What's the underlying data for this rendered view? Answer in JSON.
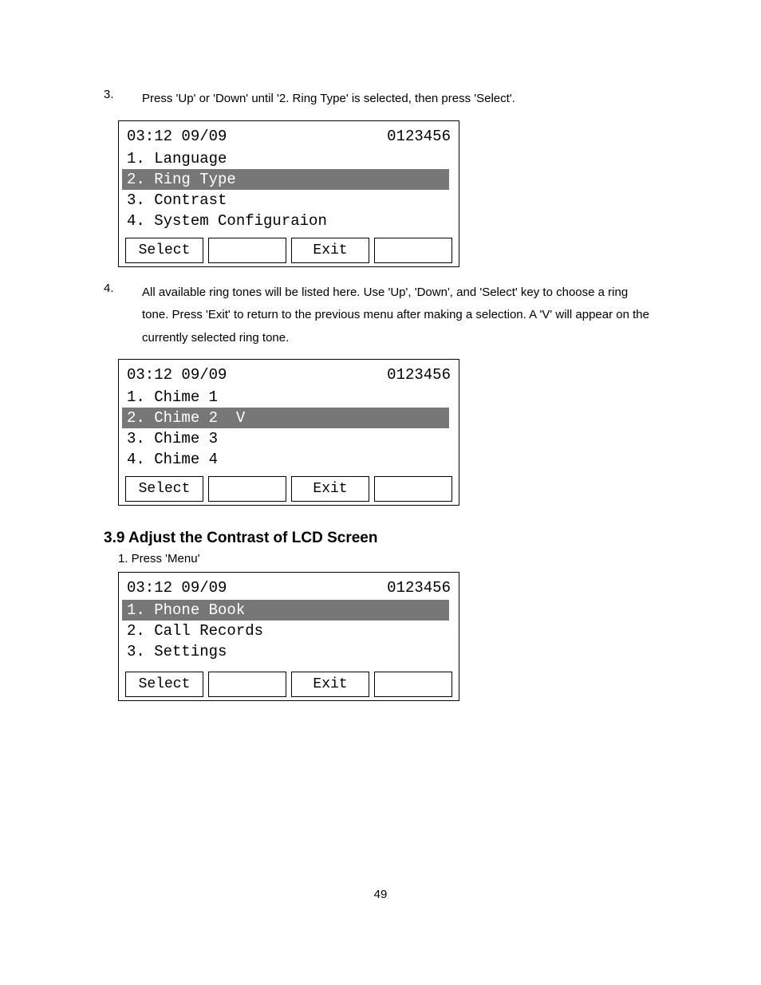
{
  "steps": {
    "step3": {
      "num": "3.",
      "text": "Press 'Up' or 'Down' until '2. Ring Type' is selected, then press 'Select'."
    },
    "step4": {
      "num": "4.",
      "text": "All available ring tones will be listed here.   Use 'Up', 'Down', and 'Select' key to choose a ring tone.   Press   'Exit' to return to the previous menu after making a selection.   A 'V' will appear on the currently selected ring tone."
    }
  },
  "lcd1": {
    "time": "03:12 09/09",
    "number": "0123456",
    "items": [
      {
        "label": "1. Language",
        "selected": false
      },
      {
        "label": "2. Ring Type",
        "selected": true
      },
      {
        "label": "3. Contrast",
        "selected": false
      },
      {
        "label": "4. System Configuraion",
        "selected": false
      }
    ],
    "softkeys": [
      "Select",
      "",
      "Exit",
      ""
    ]
  },
  "lcd2": {
    "time": "03:12 09/09",
    "number": "0123456",
    "items": [
      {
        "label": "1. Chime 1",
        "selected": false
      },
      {
        "label": "2. Chime 2  V",
        "selected": true
      },
      {
        "label": "3. Chime 3",
        "selected": false
      },
      {
        "label": "4. Chime 4",
        "selected": false
      }
    ],
    "softkeys": [
      "Select",
      "",
      "Exit",
      ""
    ]
  },
  "section": {
    "heading": "3.9 Adjust the Contrast of LCD Screen",
    "substep": "1. Press 'Menu'"
  },
  "lcd3": {
    "time": "03:12 09/09",
    "number": "0123456",
    "items": [
      {
        "label": "1. Phone Book",
        "selected": true
      },
      {
        "label": "2. Call Records",
        "selected": false
      },
      {
        "label": "3. Settings",
        "selected": false
      },
      {
        "label": "",
        "selected": false
      }
    ],
    "softkeys": [
      "Select",
      "",
      "Exit",
      ""
    ]
  },
  "page_number": "49"
}
